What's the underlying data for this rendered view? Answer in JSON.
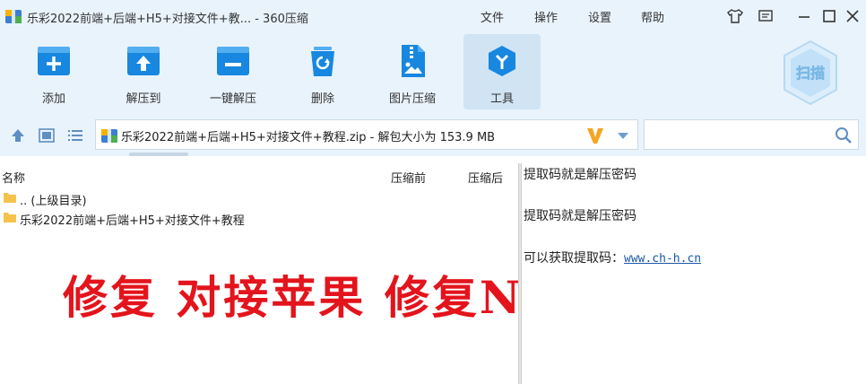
{
  "window": {
    "title": "乐彩2022前端+后端+H5+对接文件+教... - 360压缩",
    "menu": [
      "文件",
      "操作",
      "设置",
      "帮助"
    ],
    "controls": [
      "skin-icon",
      "feedback-icon",
      "minimize-icon",
      "maximize-icon",
      "close-icon"
    ]
  },
  "toolbar": {
    "tools": [
      {
        "label": "添加",
        "icon": "add-icon"
      },
      {
        "label": "解压到",
        "icon": "extract-to-icon"
      },
      {
        "label": "一键解压",
        "icon": "one-click-extract-icon"
      },
      {
        "label": "删除",
        "icon": "delete-icon"
      },
      {
        "label": "图片压缩",
        "icon": "image-compress-icon"
      },
      {
        "label": "工具",
        "icon": "tools-icon",
        "active": true
      }
    ],
    "scan_label": "扫描"
  },
  "address": {
    "path": "乐彩2022前端+后端+H5+对接文件+教程.zip - 解包大小为 153.9 MB",
    "search_placeholder": ""
  },
  "file_list": {
    "columns": {
      "name": "名称",
      "before": "压缩前",
      "after": "压缩后"
    },
    "rows": [
      {
        "name": ".. (上级目录)"
      },
      {
        "name": "乐彩2022前端+后端+H5+对接文件+教程"
      }
    ]
  },
  "overlay": "修复 对接苹果 修复N处",
  "comment": {
    "line1": "提取码就是解压密码",
    "line2": "提取码就是解压密码",
    "line3_prefix": "可以获取提取码：",
    "line3_link": "www.ch-h.cn"
  },
  "colors": {
    "chrome_bg": "#e9f3fb",
    "icon_blue": "#1787e0",
    "accent_red": "#e3141c",
    "link": "#1a57a6"
  }
}
